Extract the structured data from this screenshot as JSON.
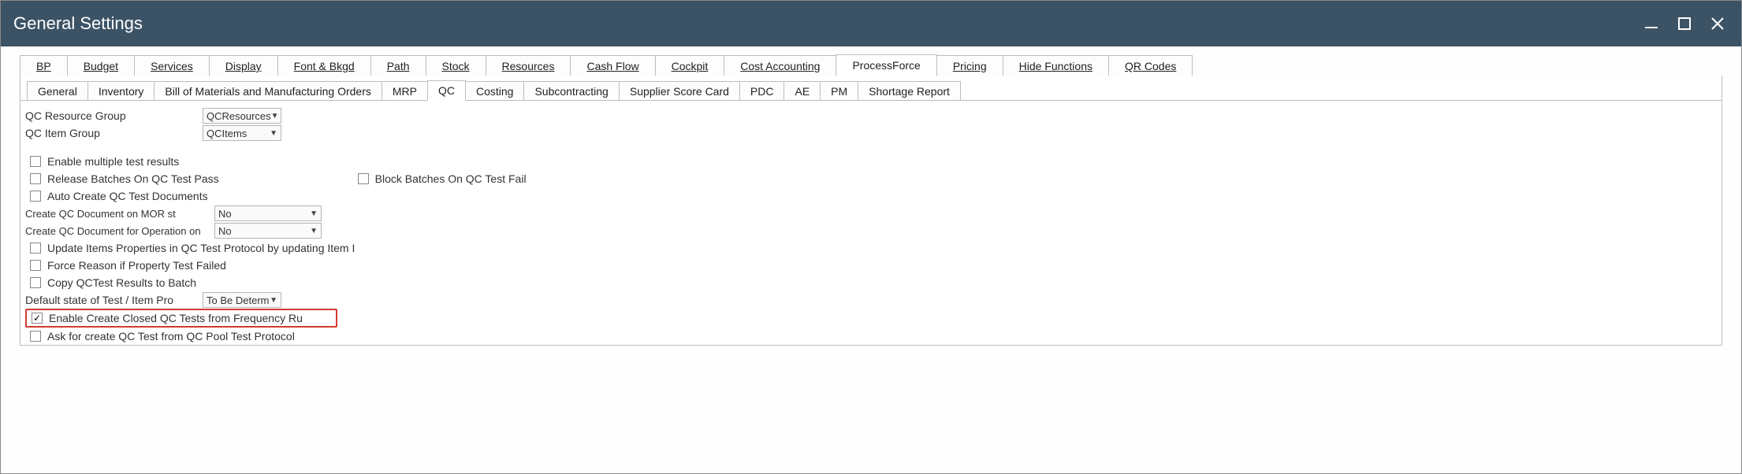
{
  "window": {
    "title": "General Settings"
  },
  "tabs_main": {
    "bp": "BP",
    "budget": "Budget",
    "services": "Services",
    "display": "Display",
    "font_bkgd": "Font & Bkgd",
    "path": "Path",
    "stock": "Stock",
    "resources": "Resources",
    "cash_flow": "Cash Flow",
    "cockpit": "Cockpit",
    "cost_accounting": "Cost Accounting",
    "process_force": "ProcessForce",
    "pricing": "Pricing",
    "hide_functions": "Hide Functions",
    "qr_codes": "QR Codes"
  },
  "tabs_sub": {
    "general": "General",
    "inventory": "Inventory",
    "bom_mo": "Bill of Materials and Manufacturing Orders",
    "mrp": "MRP",
    "qc": "QC",
    "costing": "Costing",
    "subcontracting": "Subcontracting",
    "supplier_score": "Supplier Score Card",
    "pdc": "PDC",
    "ae": "AE",
    "pm": "PM",
    "shortage": "Shortage Report"
  },
  "form": {
    "qc_resource_group_label": "QC Resource Group",
    "qc_resource_group_value": "QCResources",
    "qc_item_group_label": "QC Item Group",
    "qc_item_group_value": "QCItems",
    "enable_multiple": "Enable multiple test results",
    "release_batches": "Release Batches On QC Test Pass",
    "block_batches": "Block Batches On QC Test Fail",
    "auto_create": "Auto Create QC Test Documents",
    "create_qc_mor_label": "Create QC Document on MOR st",
    "create_qc_mor_value": "No",
    "create_qc_op_label": "Create QC Document for Operation on",
    "create_qc_op_value": "No",
    "update_items": "Update Items Properties in QC Test Protocol by updating Item I",
    "force_reason": "Force Reason if Property Test Failed",
    "copy_results": "Copy QCTest Results to Batch",
    "default_state_label": "Default state of Test / Item Pro",
    "default_state_value": "To Be Determ",
    "enable_closed": "Enable Create Closed QC Tests from Frequency Ru",
    "ask_create": "Ask for create QC Test from QC Pool Test Protocol"
  }
}
